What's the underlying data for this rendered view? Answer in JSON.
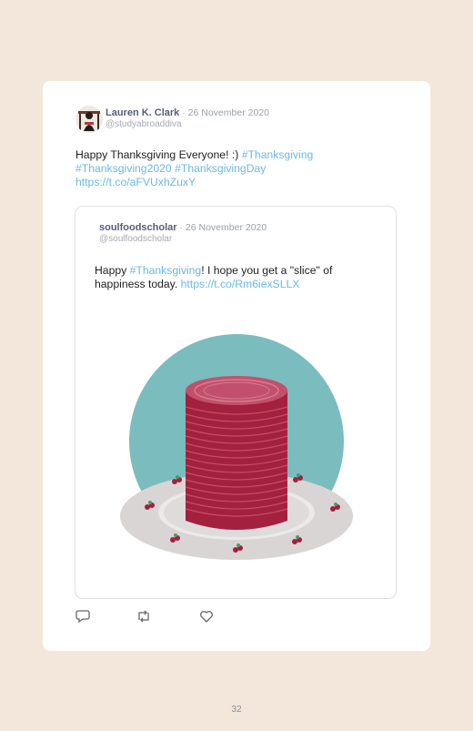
{
  "tweet": {
    "author_name": "Lauren K. Clark",
    "separator": " · ",
    "date": "26 November 2020",
    "handle": "@studyabroaddiva",
    "text_plain": "Happy Thanksgiving Everyone! :) ",
    "hashtag_1": "#Thanksgiving",
    "hashtag_2": "#Thanksgiving2020",
    "hashtag_3": "#ThanksgivingDay",
    "link": "https://t.co/aFVUxhZuxY"
  },
  "quoted_tweet": {
    "author_name": "soulfoodscholar",
    "separator": " · ",
    "date": "26 November 2020",
    "handle": "@soulfoodscholar",
    "text_before": "Happy ",
    "hashtag": "#Thanksgiving",
    "text_after": "! I hope you get a \"slice\" of happiness today. ",
    "link": "https://t.co/Rm6iexSLLX",
    "image_description_icon": "cranberry-sauce-can-illustration"
  },
  "actions": {
    "reply_icon": "reply-icon",
    "retweet_icon": "retweet-icon",
    "like_icon": "like-icon"
  },
  "page_number": "32",
  "colors": {
    "background": "#f3e7dc",
    "card": "#ffffff",
    "link": "#6ab8e8",
    "author": "#555e79",
    "cranberry": "#a3203f",
    "teal_circle": "#7bbcbf",
    "plate": "#d9d5d5"
  }
}
